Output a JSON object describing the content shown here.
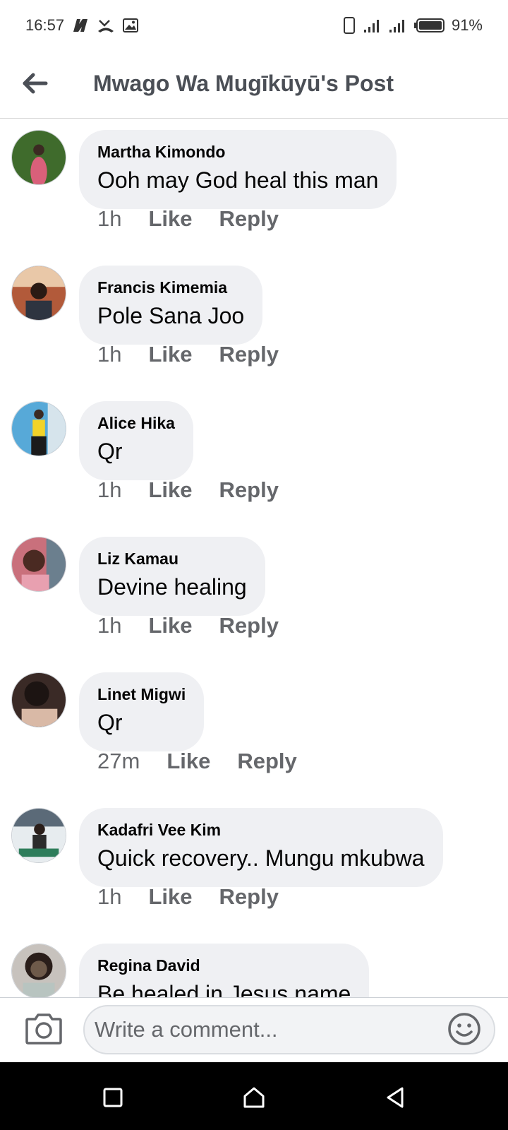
{
  "status_bar": {
    "time": "16:57",
    "battery": "91%",
    "icons_left": [
      "netflix-icon",
      "missed-call-icon",
      "image-icon"
    ],
    "icons_right": [
      "phone-icon",
      "signal-icon",
      "signal-icon",
      "battery-icon"
    ]
  },
  "header": {
    "title": "Mwago Wa Mugīkūyū's Post"
  },
  "comments": [
    {
      "author": "Martha Kimondo",
      "text": "Ooh may God heal this man",
      "time": "1h",
      "like": "Like",
      "reply": "Reply",
      "avatar_color": "#3f6b2c"
    },
    {
      "author": "Francis Kimemia",
      "text": "Pole Sana Joo",
      "time": "1h",
      "like": "Like",
      "reply": "Reply",
      "avatar_color": "#b25a3a"
    },
    {
      "author": "Alice Hika",
      "text": "Qr",
      "time": "1h",
      "like": "Like",
      "reply": "Reply",
      "avatar_color": "#57a9d8"
    },
    {
      "author": "Liz Kamau",
      "text": "Devine healing",
      "time": "1h",
      "like": "Like",
      "reply": "Reply",
      "avatar_color": "#c9707c"
    },
    {
      "author": "Linet Migwi",
      "text": "Qr",
      "time": "27m",
      "like": "Like",
      "reply": "Reply",
      "avatar_color": "#3a2a26"
    },
    {
      "author": "Kadafri Vee Kim",
      "text": "Quick recovery.. Mungu mkubwa",
      "time": "1h",
      "like": "Like",
      "reply": "Reply",
      "avatar_color": "#5b6a78"
    },
    {
      "author": "Regina David",
      "text": "Be healed in Jesus name",
      "avatar_color": "#6e5a4a"
    }
  ],
  "composer": {
    "placeholder": "Write a comment..."
  },
  "colors": {
    "bubble": "#eff0f3",
    "secondary_text": "#65676b",
    "header_text": "#4b4f56"
  }
}
